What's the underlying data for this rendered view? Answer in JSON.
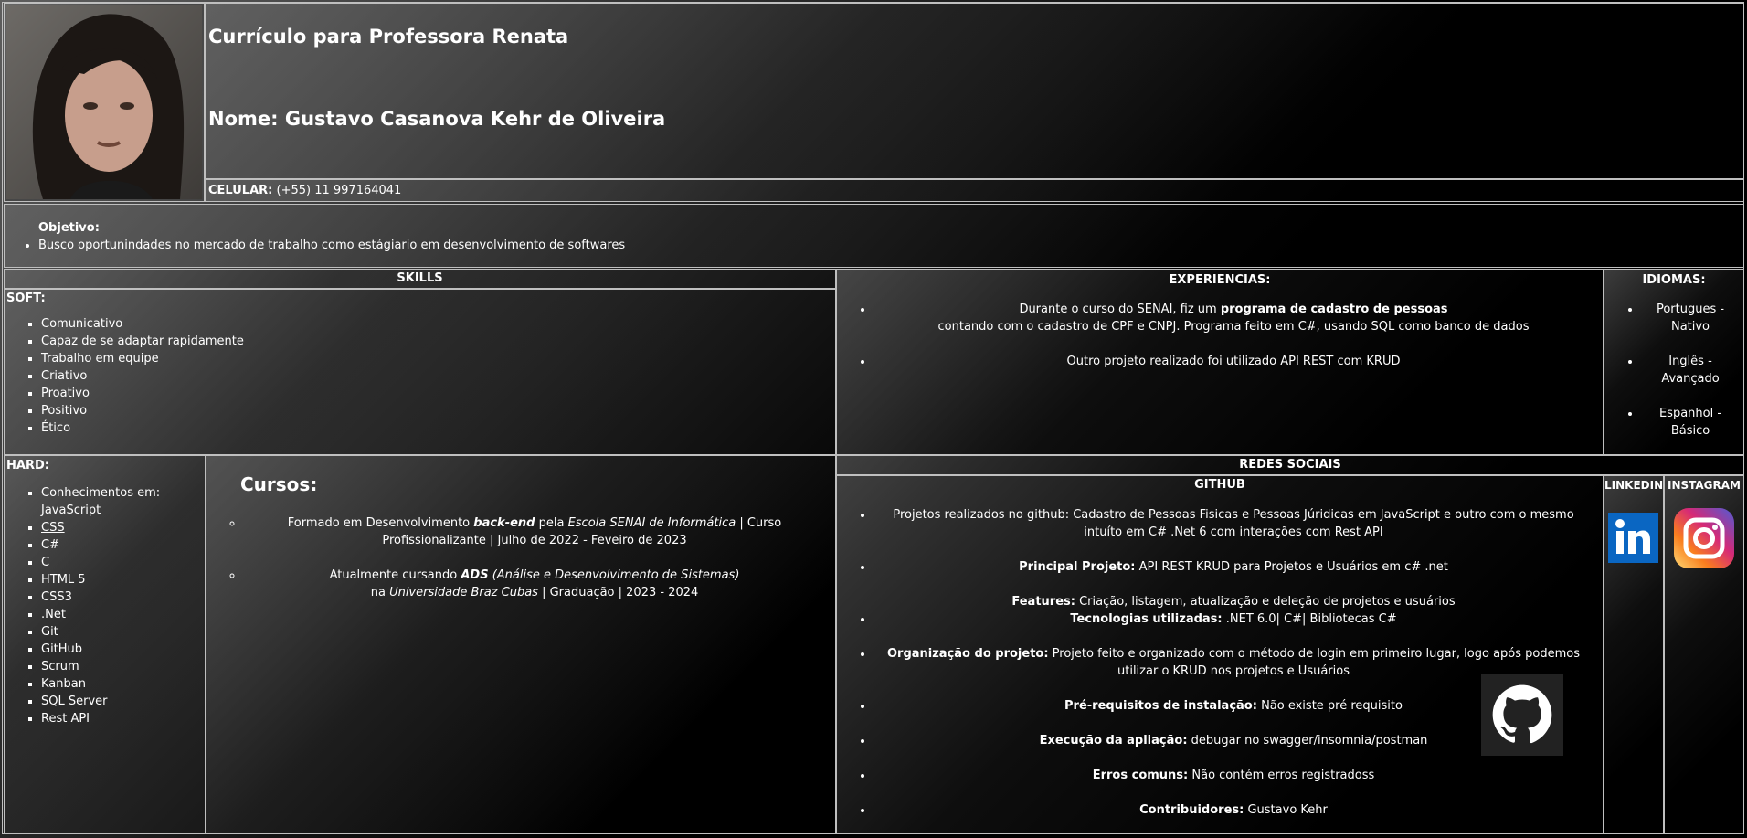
{
  "header": {
    "title": "Currículo para Professora Renata",
    "name": "Nome: Gustavo Casanova Kehr de Oliveira",
    "phone_label": "CELULAR:",
    "phone_value": " (+55) 11 997164041"
  },
  "objective": {
    "label": "Objetivo:",
    "text": "Busco oportunindades no mercado de trabalho como estágiario em desenvolvimento de softwares"
  },
  "skills": {
    "header": "SKILLS",
    "soft_label": "SOFT:",
    "soft": [
      "Comunicativo",
      "Capaz de se adaptar rapidamente",
      "Trabalho em equipe",
      "Criativo",
      "Proativo",
      "Positivo",
      "Ético"
    ],
    "hard_label": "HARD:",
    "hard": [
      "Conhecimentos em: JavaScript",
      "CSS",
      "C#",
      "C",
      "HTML 5",
      "CSS3",
      ".Net",
      "Git",
      "GitHub",
      "Scrum",
      "Kanban",
      "SQL Server",
      "Rest API"
    ]
  },
  "experiences": {
    "header": "EXPERIENCIAS:",
    "item1_a": "Durante o curso do SENAI, fiz um ",
    "item1_b": "programa de cadastro de pessoas",
    "item1_c": "contando com o cadastro de CPF e CNPJ. Programa feito em C#, usando SQL como banco de dados",
    "item2": "Outro projeto realizado foi utilizado API REST com KRUD"
  },
  "languages": {
    "header": "IDIOMAS:",
    "items": [
      "Portugues - Nativo",
      "Inglês - Avançado",
      "Espanhol - Básico"
    ]
  },
  "courses": {
    "title": "Cursos:",
    "c1_a": "Formado em Desenvolvimento ",
    "c1_b": "back-end",
    "c1_c": " pela ",
    "c1_d": "Escola SENAI de Informática",
    "c1_e": " | Curso Profissionalizante | Julho de 2022 - Feveiro de 2023",
    "c2_a": "Atualmente cursando ",
    "c2_b": "ADS",
    "c2_c": " (Análise e Desenvolvimento de Sistemas)",
    "c2_d": "na ",
    "c2_e": "Universidade Braz Cubas",
    "c2_f": " | Graduação | 2023 - 2024"
  },
  "social": {
    "header": "REDES SOCIAIS",
    "github": "GITHUB",
    "linkedin": "LINKEDIN",
    "instagram": "INSTAGRAM",
    "items": [
      {
        "label": "",
        "value": "Projetos realizados no github: Cadastro de Pessoas Fisicas e Pessoas Júridicas em JavaScript e outro com o mesmo intuíto em C# .Net 6 com interações com Rest API"
      },
      {
        "label": "Principal Projeto:",
        "value": " API REST KRUD para Projetos e Usuários em c# .net"
      },
      {
        "label": "Features:",
        "value": " Criação, listagem, atualização e deleção de projetos e usuários"
      },
      {
        "label": "Tecnologias utilizadas:",
        "value": " .NET 6.0| C#| Bibliotecas C#"
      },
      {
        "label": "Organização do projeto:",
        "value": " Projeto feito e organizado com o método de login em primeiro lugar, logo após podemos utilizar o KRUD nos projetos e Usuários"
      },
      {
        "label": "Pré-requisitos de instalação:",
        "value": " Não existe pré requisito"
      },
      {
        "label": "Execução da apliação:",
        "value": " debugar no swagger/insomnia/postman"
      },
      {
        "label": "Erros comuns:",
        "value": " Não contém erros registradoss"
      },
      {
        "label": "Contribuidores:",
        "value": " Gustavo Kehr"
      }
    ]
  },
  "colors": {
    "linkedin": "#0a66c2",
    "border": "#bfbfbf"
  }
}
